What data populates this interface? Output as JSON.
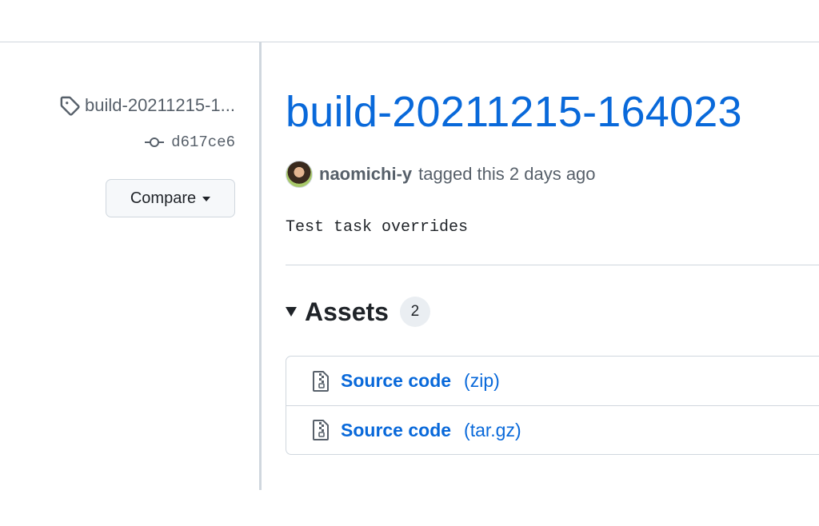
{
  "sidebar": {
    "tag_label": "build-20211215-164023",
    "tag_display": "build-20211215-1...",
    "commit": "d617ce6",
    "compare_label": "Compare"
  },
  "release": {
    "title": "build-20211215-164023",
    "author": "naomichi-y",
    "action_text": "tagged this 2 days ago",
    "body": "Test task overrides"
  },
  "assets": {
    "title": "Assets",
    "count": "2",
    "items": [
      {
        "name": "Source code",
        "ext": "(zip)",
        "icon": "file-zip-icon"
      },
      {
        "name": "Source code",
        "ext": "(tar.gz)",
        "icon": "file-zip-icon"
      }
    ]
  },
  "colors": {
    "link": "#0969da",
    "muted": "#57606a",
    "border": "#d0d7de"
  }
}
